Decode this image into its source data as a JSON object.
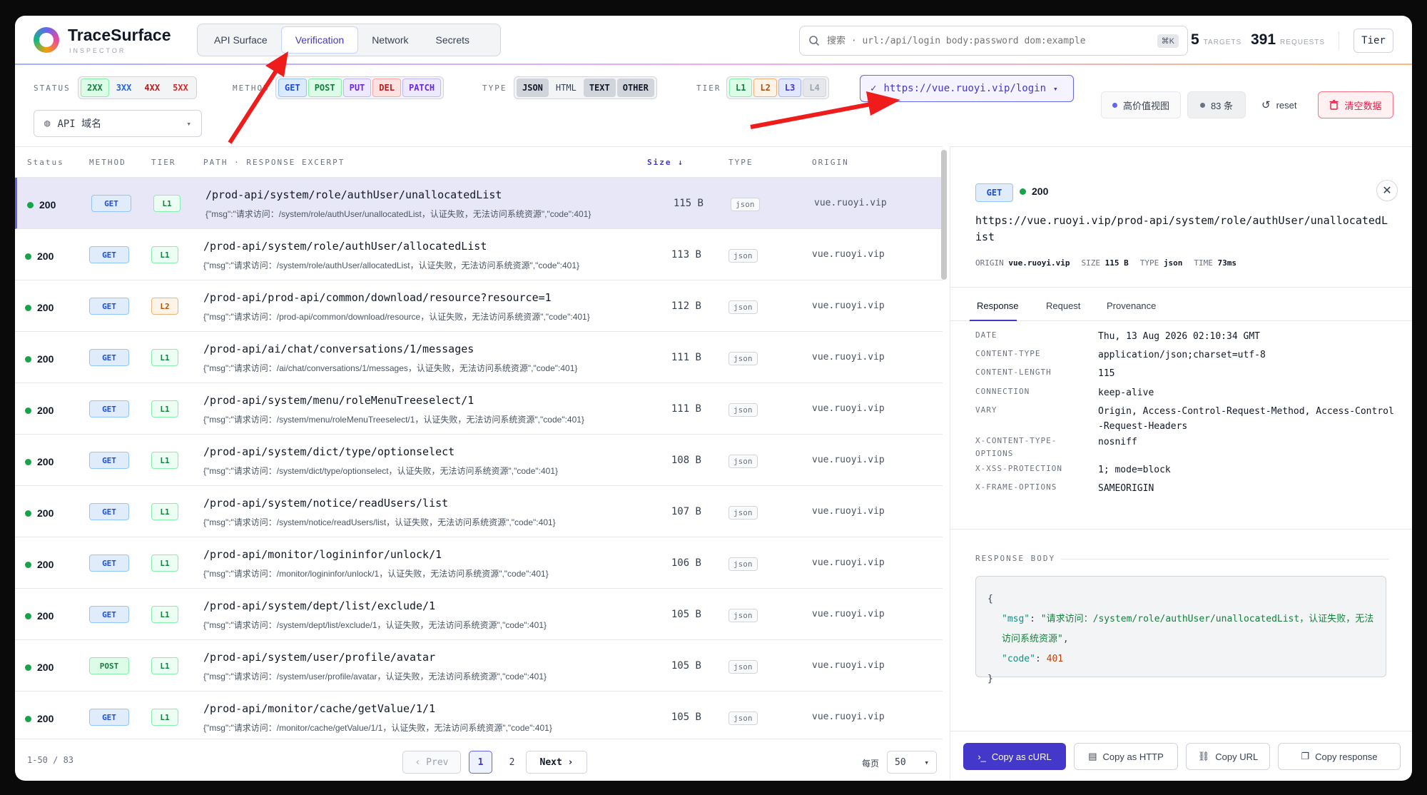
{
  "app": {
    "name": "TraceSurface",
    "subtitle": "INSPECTOR"
  },
  "nav_tabs": [
    {
      "label": "API Surface"
    },
    {
      "label": "Verification"
    },
    {
      "label": "Network"
    },
    {
      "label": "Secrets"
    }
  ],
  "search": {
    "placeholder": "搜索 · url:/api/login body:password dom:example",
    "shortcut": "⌘K"
  },
  "stats": {
    "targets_value": "5",
    "targets_label": "TARGETS",
    "requests_value": "391",
    "requests_label": "REQUESTS"
  },
  "tier_button": "Tier",
  "filters": {
    "status_label": "STATUS",
    "status_chips": [
      "2XX",
      "3XX",
      "4XX",
      "5XX"
    ],
    "method_label": "METHOD",
    "method_chips": [
      "GET",
      "POST",
      "PUT",
      "DEL",
      "PATCH"
    ],
    "type_label": "TYPE",
    "type_chips": [
      "JSON",
      "HTML",
      "TEXT",
      "OTHER"
    ],
    "tier_label": "TIER",
    "tier_chips": [
      "L1",
      "L2",
      "L3",
      "L4"
    ],
    "url_selected": "https://vue.ruoyi.vip/login",
    "domain_select": "API 域名",
    "high_value_view": "高价值视图",
    "count": "83 条",
    "reset": "reset",
    "clear": "清空数据"
  },
  "table": {
    "headers": {
      "status": "Status",
      "method": "METHOD",
      "tier": "TIER",
      "path": "PATH · RESPONSE EXCERPT",
      "size": "Size ↓",
      "type": "TYPE",
      "origin": "ORIGIN"
    },
    "rows": [
      {
        "status": "200",
        "method": "GET",
        "tier": "L1",
        "path": "/prod-api/system/role/authUser/unallocatedList",
        "excerpt": "{\"msg\":\"请求访问：/system/role/authUser/unallocatedList，认证失败，无法访问系统资源\",\"code\":401}",
        "size": "115 B",
        "type": "json",
        "origin": "vue.ruoyi.vip"
      },
      {
        "status": "200",
        "method": "GET",
        "tier": "L1",
        "path": "/prod-api/system/role/authUser/allocatedList",
        "excerpt": "{\"msg\":\"请求访问：/system/role/authUser/allocatedList，认证失败，无法访问系统资源\",\"code\":401}",
        "size": "113 B",
        "type": "json",
        "origin": "vue.ruoyi.vip"
      },
      {
        "status": "200",
        "method": "GET",
        "tier": "L2",
        "path": "/prod-api/prod-api/common/download/resource?resource=1",
        "excerpt": "{\"msg\":\"请求访问：/prod-api/common/download/resource，认证失败，无法访问系统资源\",\"code\":401}",
        "size": "112 B",
        "type": "json",
        "origin": "vue.ruoyi.vip"
      },
      {
        "status": "200",
        "method": "GET",
        "tier": "L1",
        "path": "/prod-api/ai/chat/conversations/1/messages",
        "excerpt": "{\"msg\":\"请求访问：/ai/chat/conversations/1/messages，认证失败，无法访问系统资源\",\"code\":401}",
        "size": "111 B",
        "type": "json",
        "origin": "vue.ruoyi.vip"
      },
      {
        "status": "200",
        "method": "GET",
        "tier": "L1",
        "path": "/prod-api/system/menu/roleMenuTreeselect/1",
        "excerpt": "{\"msg\":\"请求访问：/system/menu/roleMenuTreeselect/1，认证失败，无法访问系统资源\",\"code\":401}",
        "size": "111 B",
        "type": "json",
        "origin": "vue.ruoyi.vip"
      },
      {
        "status": "200",
        "method": "GET",
        "tier": "L1",
        "path": "/prod-api/system/dict/type/optionselect",
        "excerpt": "{\"msg\":\"请求访问：/system/dict/type/optionselect，认证失败，无法访问系统资源\",\"code\":401}",
        "size": "108 B",
        "type": "json",
        "origin": "vue.ruoyi.vip"
      },
      {
        "status": "200",
        "method": "GET",
        "tier": "L1",
        "path": "/prod-api/system/notice/readUsers/list",
        "excerpt": "{\"msg\":\"请求访问：/system/notice/readUsers/list，认证失败，无法访问系统资源\",\"code\":401}",
        "size": "107 B",
        "type": "json",
        "origin": "vue.ruoyi.vip"
      },
      {
        "status": "200",
        "method": "GET",
        "tier": "L1",
        "path": "/prod-api/monitor/logininfor/unlock/1",
        "excerpt": "{\"msg\":\"请求访问：/monitor/logininfor/unlock/1，认证失败，无法访问系统资源\",\"code\":401}",
        "size": "106 B",
        "type": "json",
        "origin": "vue.ruoyi.vip"
      },
      {
        "status": "200",
        "method": "GET",
        "tier": "L1",
        "path": "/prod-api/system/dept/list/exclude/1",
        "excerpt": "{\"msg\":\"请求访问：/system/dept/list/exclude/1，认证失败，无法访问系统资源\",\"code\":401}",
        "size": "105 B",
        "type": "json",
        "origin": "vue.ruoyi.vip"
      },
      {
        "status": "200",
        "method": "POST",
        "tier": "L1",
        "path": "/prod-api/system/user/profile/avatar",
        "excerpt": "{\"msg\":\"请求访问：/system/user/profile/avatar，认证失败，无法访问系统资源\",\"code\":401}",
        "size": "105 B",
        "type": "json",
        "origin": "vue.ruoyi.vip"
      },
      {
        "status": "200",
        "method": "GET",
        "tier": "L1",
        "path": "/prod-api/monitor/cache/getValue/1/1",
        "excerpt": "{\"msg\":\"请求访问：/monitor/cache/getValue/1/1，认证失败，无法访问系统资源\",\"code\":401}",
        "size": "105 B",
        "type": "json",
        "origin": "vue.ruoyi.vip"
      }
    ]
  },
  "pagination": {
    "range": "1-50 / 83",
    "prev": "Prev",
    "page1": "1",
    "page2": "2",
    "next": "Next",
    "per_page_label": "每页",
    "per_page": "50"
  },
  "detail": {
    "method": "GET",
    "status": "200",
    "url": "https://vue.ruoyi.vip/prod-api/system/role/authUser/unallocatedList",
    "origin_label": "ORIGIN",
    "origin": "vue.ruoyi.vip",
    "size_label": "SIZE",
    "size": "115 B",
    "type_label": "TYPE",
    "type": "json",
    "time_label": "TIME",
    "time": "73ms",
    "tabs": [
      "Response",
      "Request",
      "Provenance"
    ],
    "headers": [
      {
        "k": "DATE",
        "v": "Thu, 13 Aug 2026 02:10:34 GMT"
      },
      {
        "k": "CONTENT-TYPE",
        "v": "application/json;charset=utf-8"
      },
      {
        "k": "CONTENT-LENGTH",
        "v": "115"
      },
      {
        "k": "CONNECTION",
        "v": "keep-alive"
      },
      {
        "k": "VARY",
        "v": "Origin, Access-Control-Request-Method, Access-Control-Request-Headers"
      },
      {
        "k": "X-CONTENT-TYPE-OPTIONS",
        "v": "nosniff"
      },
      {
        "k": "X-XSS-PROTECTION",
        "v": "1; mode=block"
      },
      {
        "k": "X-FRAME-OPTIONS",
        "v": "SAMEORIGIN"
      }
    ],
    "body_label": "RESPONSE BODY",
    "body": {
      "open": "{",
      "k1": "\"msg\"",
      "v1": "\"请求访问：/system/role/authUser/unallocatedList，认证失败，无法访问系统资源\"",
      "k2": "\"code\"",
      "v2": "401",
      "close": "}"
    },
    "actions": [
      "Copy as cURL",
      "Copy as HTTP",
      "Copy URL",
      "Copy response"
    ]
  },
  "colors": {
    "accent": "#4338ca",
    "annotation_arrow": "#ef1c1c",
    "ok_dot": "#16a34a",
    "danger": "#e11d48"
  }
}
